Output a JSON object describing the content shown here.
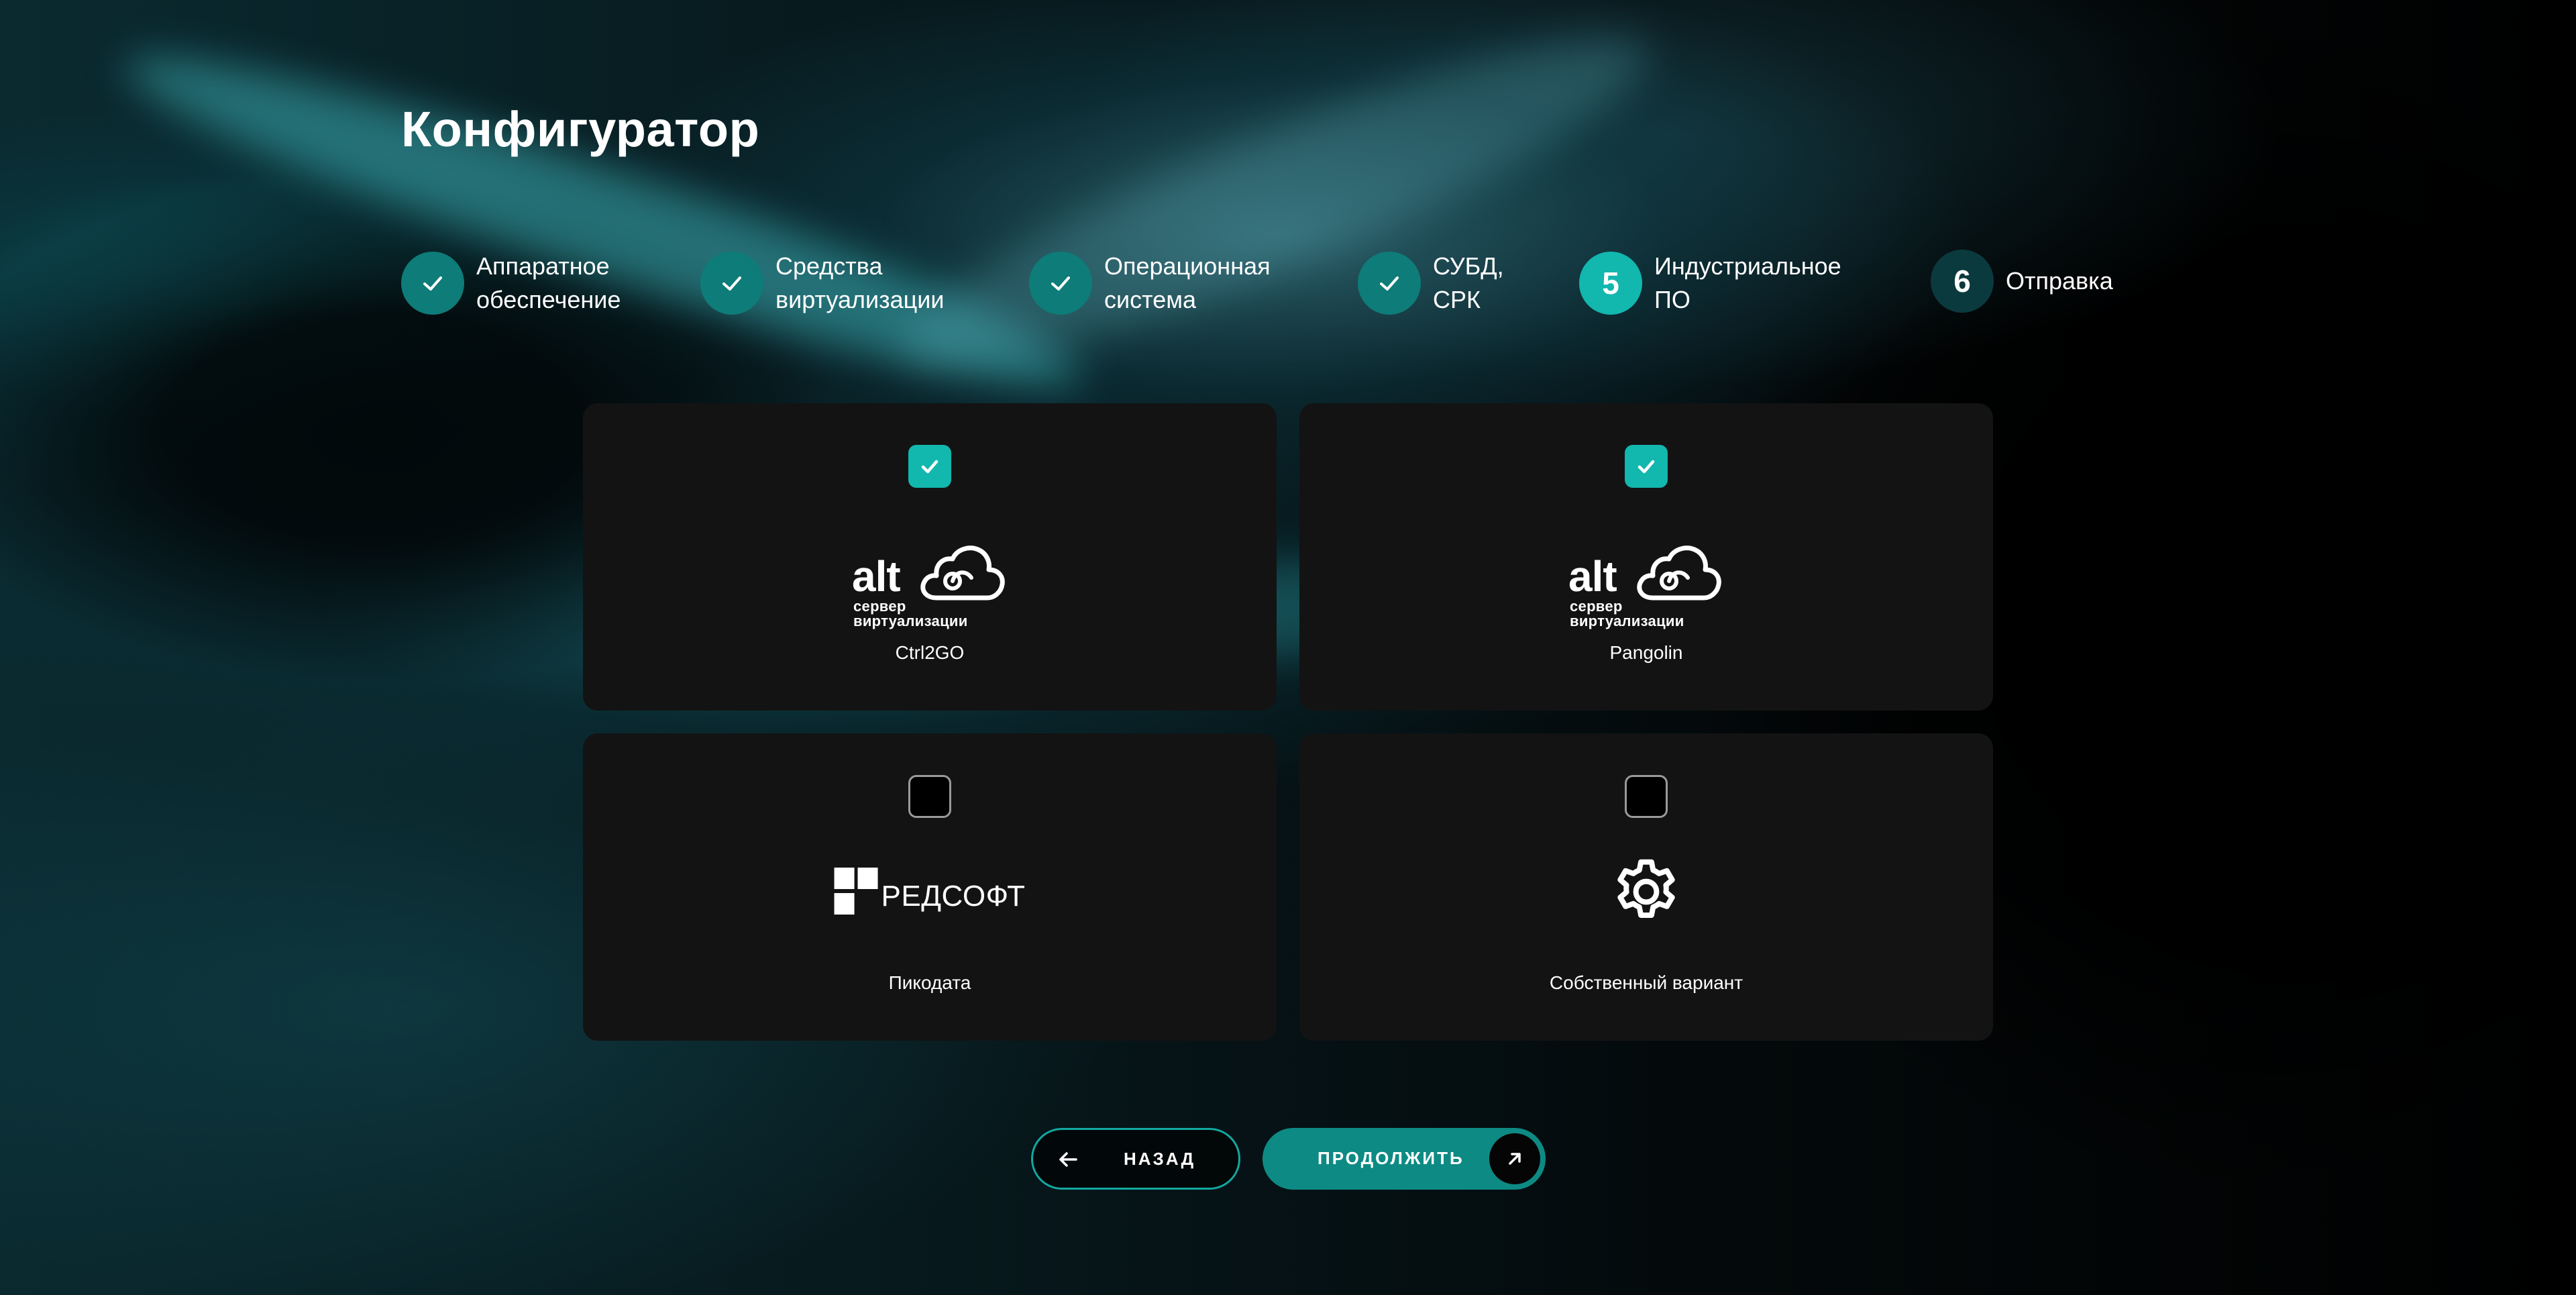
{
  "page": {
    "title": "Конфигуратор"
  },
  "colors": {
    "accent": "#12b7ae",
    "step_done": "#0e7c78",
    "step_pending": "#0b3a3e",
    "card_bg": "#131313"
  },
  "stepper": {
    "steps": [
      {
        "state": "done",
        "number": "",
        "label_line1": "Аппаратное",
        "label_line2": "обеспечение",
        "icon": "check-icon"
      },
      {
        "state": "done",
        "number": "",
        "label_line1": "Средства",
        "label_line2": "виртуализации",
        "icon": "check-icon"
      },
      {
        "state": "done",
        "number": "",
        "label_line1": "Операционная",
        "label_line2": "система",
        "icon": "check-icon"
      },
      {
        "state": "done",
        "number": "",
        "label_line1": "СУБД,",
        "label_line2": "СРК",
        "icon": "check-icon"
      },
      {
        "state": "active",
        "number": "5",
        "label_line1": "Индустриальное",
        "label_line2": "ПО"
      },
      {
        "state": "pending",
        "number": "6",
        "label_line1": "Отправка",
        "label_line2": ""
      }
    ]
  },
  "options": [
    {
      "label": "Ctrl2GO",
      "checked": true,
      "logo": {
        "type": "alt",
        "word": "alt",
        "line1": "сервер",
        "line2": "виртуализации"
      }
    },
    {
      "label": "Pangolin",
      "checked": true,
      "logo": {
        "type": "alt",
        "word": "alt",
        "line1": "сервер",
        "line2": "виртуализации"
      }
    },
    {
      "label": "Пикодата",
      "checked": false,
      "logo": {
        "type": "redsoft",
        "word": "РЕДСОФТ"
      }
    },
    {
      "label": "Собственный вариант",
      "checked": false,
      "logo": {
        "type": "gear",
        "icon": "gear-icon"
      }
    }
  ],
  "actions": {
    "back_label": "НАЗАД",
    "back_icon": "arrow-left-icon",
    "next_label": "ПРОДОЛЖИТЬ",
    "next_icon": "arrow-up-right-icon"
  }
}
